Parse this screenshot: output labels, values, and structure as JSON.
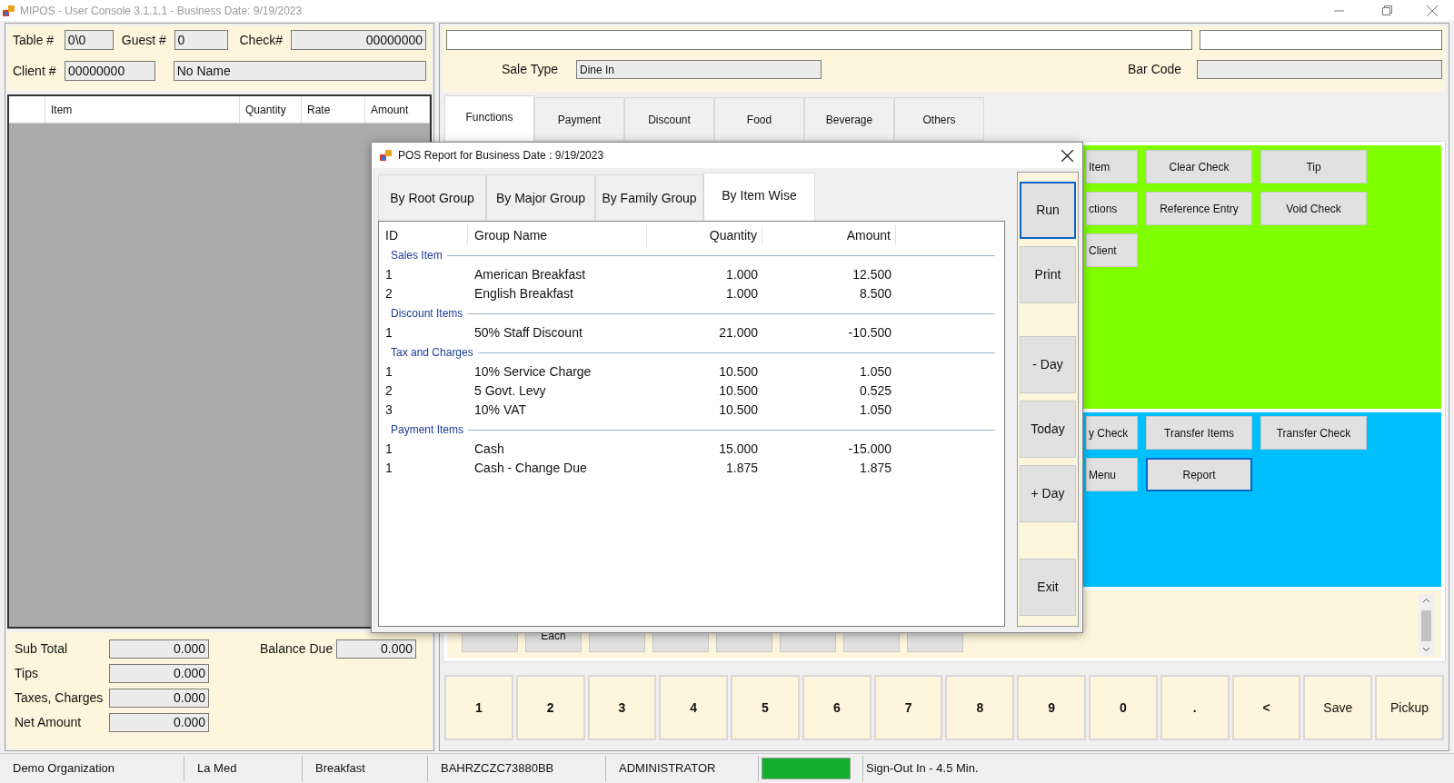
{
  "window": {
    "title": "MIPOS - User Console 3.1.1.1 - Business Date: 9/19/2023"
  },
  "check_header": {
    "table": {
      "label": "Table #",
      "value": "0\\0"
    },
    "guest": {
      "label": "Guest #",
      "value": "0"
    },
    "check": {
      "label": "Check#",
      "value": "00000000"
    },
    "client": {
      "label": "Client #",
      "value": "00000000",
      "name": "No Name"
    }
  },
  "order_grid": {
    "columns": [
      "Item",
      "Quantity",
      "Rate",
      "Amount"
    ]
  },
  "totals": [
    {
      "label": "Sub Total",
      "value": "0.000"
    },
    {
      "label": "Tips",
      "value": "0.000"
    },
    {
      "label": "Taxes, Charges",
      "value": "0.000"
    },
    {
      "label": "Net Amount",
      "value": "0.000"
    }
  ],
  "balance_due": {
    "label": "Balance Due",
    "value": "0.000"
  },
  "order_entry": {
    "sale_type": {
      "label": "Sale Type",
      "value": "Dine In"
    },
    "bar_code": {
      "label": "Bar Code"
    }
  },
  "tabs": [
    {
      "label": "Functions",
      "selected": true
    },
    {
      "label": "Payment",
      "selected": false
    },
    {
      "label": "Discount",
      "selected": false
    },
    {
      "label": "Food",
      "selected": false
    },
    {
      "label": "Beverage",
      "selected": false
    },
    {
      "label": "Others",
      "selected": false
    }
  ],
  "check_buttons": [
    [
      {
        "label": "Item"
      },
      {
        "label": "Clear Check"
      },
      {
        "label": "Tip"
      }
    ],
    [
      {
        "label": "ctions"
      },
      {
        "label": "Reference Entry"
      },
      {
        "label": "Void Check"
      }
    ],
    [
      {
        "label": "Client"
      }
    ]
  ],
  "transfer_buttons": [
    [
      {
        "label": "y Check",
        "focused": false
      },
      {
        "label": "Transfer Items",
        "focused": false
      },
      {
        "label": "Transfer Check",
        "focused": false
      }
    ],
    [
      {
        "label": "Menu",
        "focused": false
      },
      {
        "label": "Report",
        "focused": true
      }
    ]
  ],
  "list_buttons": [
    "Each"
  ],
  "keypad": [
    "1",
    "2",
    "3",
    "4",
    "5",
    "6",
    "7",
    "8",
    "9",
    "0",
    ".",
    "<",
    "Save",
    "Pickup"
  ],
  "status_bar": {
    "items": [
      "Demo Organization",
      "La Med",
      "Breakfast",
      "BAHRZCZC73880BB",
      "ADMINISTRATOR"
    ],
    "sign_out": "Sign-Out In - 4.5 Min."
  },
  "report_dialog": {
    "title": "POS Report for Business Date : 9/19/2023",
    "tabs": [
      {
        "label": "By Root Group",
        "selected": false
      },
      {
        "label": "By Major Group",
        "selected": false
      },
      {
        "label": "By Family Group",
        "selected": false
      },
      {
        "label": "By Item Wise",
        "selected": true
      }
    ],
    "columns": [
      "ID",
      "Group Name",
      "Quantity",
      "Amount"
    ],
    "sections": [
      {
        "title": "Sales Item",
        "rows": [
          {
            "id": "1",
            "name": "American Breakfast",
            "quantity": "1.000",
            "amount": "12.500"
          },
          {
            "id": "2",
            "name": "English Breakfast",
            "quantity": "1.000",
            "amount": "8.500"
          }
        ]
      },
      {
        "title": "Discount Items",
        "rows": [
          {
            "id": "1",
            "name": "50% Staff Discount",
            "quantity": "21.000",
            "amount": "-10.500"
          }
        ]
      },
      {
        "title": "Tax and Charges",
        "rows": [
          {
            "id": "1",
            "name": "10% Service Charge",
            "quantity": "10.500",
            "amount": "1.050"
          },
          {
            "id": "2",
            "name": "5 Govt. Levy",
            "quantity": "10.500",
            "amount": "0.525"
          },
          {
            "id": "3",
            "name": "10% VAT",
            "quantity": "10.500",
            "amount": "1.050"
          }
        ]
      },
      {
        "title": "Payment Items",
        "rows": [
          {
            "id": "1",
            "name": "Cash",
            "quantity": "15.000",
            "amount": "-15.000"
          },
          {
            "id": "1",
            "name": "Cash - Change Due",
            "quantity": "1.875",
            "amount": "1.875"
          }
        ]
      }
    ],
    "buttons": [
      {
        "label": "Run",
        "focused": true
      },
      {
        "label": "Print",
        "focused": false
      },
      {
        "label": "- Day",
        "focused": false
      },
      {
        "label": "Today",
        "focused": false
      },
      {
        "label": "+ Day",
        "focused": false
      },
      {
        "label": "Exit",
        "focused": false
      }
    ]
  }
}
